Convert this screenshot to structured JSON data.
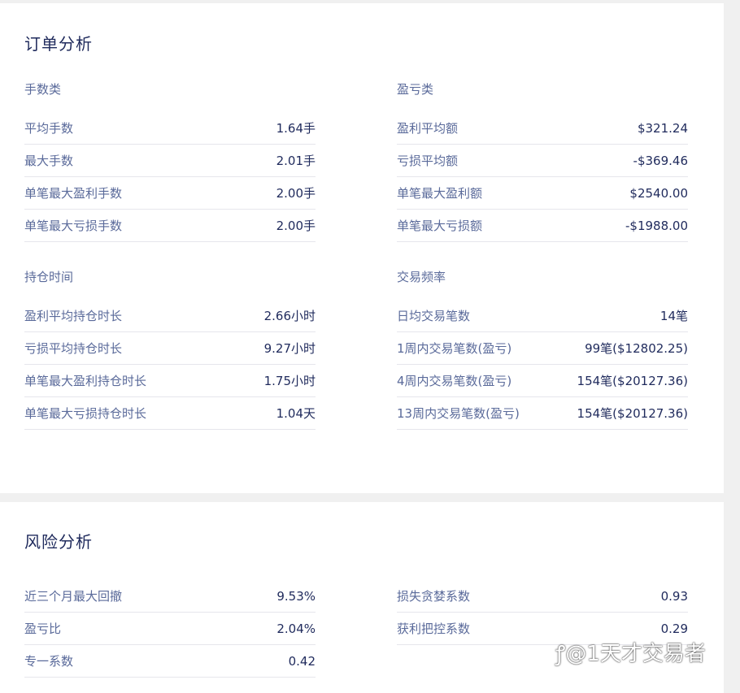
{
  "order_analysis": {
    "title": "订单分析",
    "lots": {
      "title": "手数类",
      "rows": [
        {
          "label": "平均手数",
          "value": "1.64手"
        },
        {
          "label": "最大手数",
          "value": "2.01手"
        },
        {
          "label": "单笔最大盈利手数",
          "value": "2.00手"
        },
        {
          "label": "单笔最大亏损手数",
          "value": "2.00手"
        }
      ]
    },
    "pnl": {
      "title": "盈亏类",
      "rows": [
        {
          "label": "盈利平均额",
          "value": "$321.24"
        },
        {
          "label": "亏损平均额",
          "value": "-$369.46"
        },
        {
          "label": "单笔最大盈利额",
          "value": "$2540.00"
        },
        {
          "label": "单笔最大亏损额",
          "value": "-$1988.00"
        }
      ]
    },
    "holding": {
      "title": "持仓时间",
      "rows": [
        {
          "label": "盈利平均持仓时长",
          "value": "2.66小时"
        },
        {
          "label": "亏损平均持仓时长",
          "value": "9.27小时"
        },
        {
          "label": "单笔最大盈利持仓时长",
          "value": "1.75小时"
        },
        {
          "label": "单笔最大亏损持仓时长",
          "value": "1.04天"
        }
      ]
    },
    "frequency": {
      "title": "交易频率",
      "rows": [
        {
          "label": "日均交易笔数",
          "value": "14笔"
        },
        {
          "label": "1周内交易笔数(盈亏)",
          "value": "99笔($12802.25)"
        },
        {
          "label": "4周内交易笔数(盈亏)",
          "value": "154笔($20127.36)"
        },
        {
          "label": "13周内交易笔数(盈亏)",
          "value": "154笔($20127.36)"
        }
      ]
    }
  },
  "risk_analysis": {
    "title": "风险分析",
    "left_rows": [
      {
        "label": "近三个月最大回撤",
        "value": "9.53%"
      },
      {
        "label": "盈亏比",
        "value": "2.04%"
      },
      {
        "label": "专一系数",
        "value": "0.42"
      }
    ],
    "right_rows": [
      {
        "label": "损失贪婪系数",
        "value": "0.93"
      },
      {
        "label": "获利把控系数",
        "value": "0.29"
      }
    ]
  },
  "watermark": "@1天才交易者"
}
